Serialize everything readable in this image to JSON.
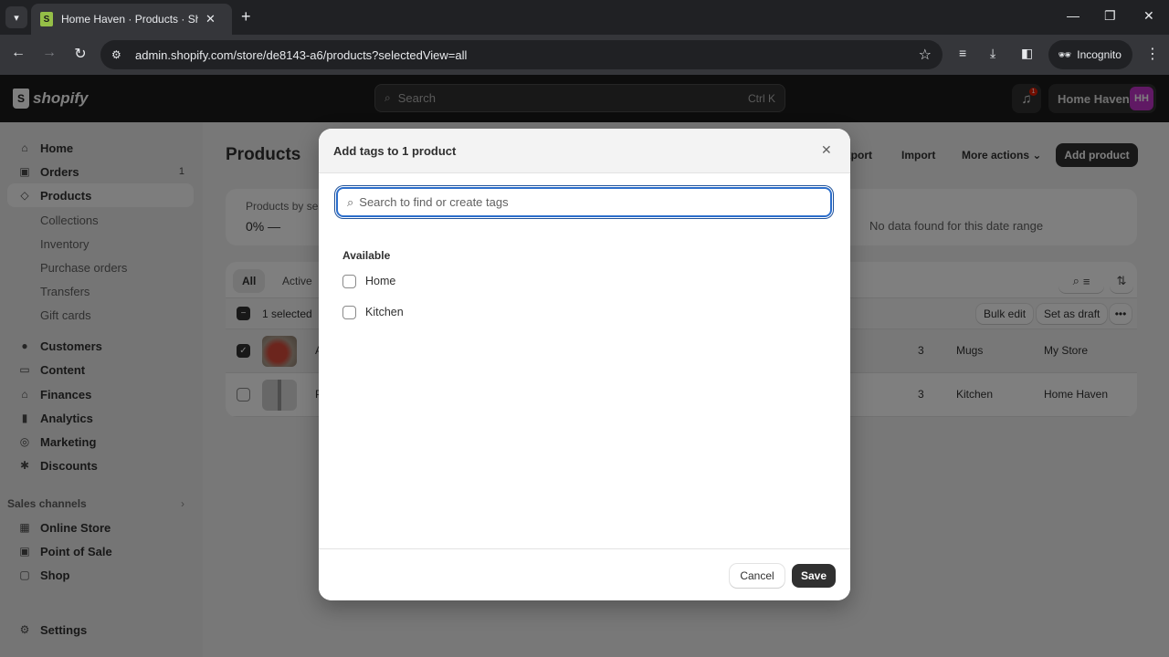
{
  "browser": {
    "tab_title": "Home Haven · Products · Shopify",
    "url": "admin.shopify.com/store/de8143-a6/products?selectedView=all",
    "incognito_label": "Incognito",
    "icons": {
      "tab_search": "▾",
      "favicon": "S",
      "tab_close": "✕",
      "new_tab": "+",
      "back": "←",
      "forward": "→",
      "reload": "↻",
      "site_info": "⚙",
      "star": "☆",
      "media": "≡",
      "download": "⤓",
      "sidepanel": "◧",
      "incognito": "🕶",
      "menu": "⋮",
      "minimize": "—",
      "restore": "❐",
      "close": "✕"
    }
  },
  "topbar": {
    "logo_text": "shopify",
    "search_placeholder": "Search",
    "search_shortcut": "Ctrl K",
    "notification_count": "1",
    "store_name": "Home Haven",
    "avatar_initials": "HH",
    "avatar_color": "#c032c8"
  },
  "sidebar": {
    "items": [
      {
        "label": "Home",
        "icon": "⌂"
      },
      {
        "label": "Orders",
        "icon": "▣",
        "badge": "1"
      },
      {
        "label": "Products",
        "icon": "◇",
        "active": true
      }
    ],
    "product_subitems": [
      "Collections",
      "Inventory",
      "Purchase orders",
      "Transfers",
      "Gift cards"
    ],
    "items2": [
      {
        "label": "Customers",
        "icon": "●"
      },
      {
        "label": "Content",
        "icon": "▭"
      },
      {
        "label": "Finances",
        "icon": "⌂"
      },
      {
        "label": "Analytics",
        "icon": "▮"
      },
      {
        "label": "Marketing",
        "icon": "◎"
      },
      {
        "label": "Discounts",
        "icon": "✱"
      }
    ],
    "sales_channels_label": "Sales channels",
    "channels": [
      {
        "label": "Online Store",
        "icon": "▦"
      },
      {
        "label": "Point of Sale",
        "icon": "▣"
      },
      {
        "label": "Shop",
        "icon": "▢"
      }
    ],
    "settings_label": "Settings",
    "settings_icon": "⚙"
  },
  "main": {
    "page_title": "Products",
    "header_buttons": {
      "export": "Export",
      "import": "Import",
      "more_actions": "More actions ⌄",
      "add_product": "Add product"
    },
    "stats": {
      "label": "Products by sell-through rate",
      "value": "0%  —",
      "message": "No data found for this date range"
    },
    "filter_tabs": [
      "All",
      "Active"
    ],
    "selected_count": "1 selected",
    "bulk_actions": {
      "bulk_edit": "Bulk edit",
      "set_as_draft": "Set as draft",
      "more": "•••"
    },
    "rows": [
      {
        "selected": true,
        "title": "A",
        "inventory": "3",
        "type": "Mugs",
        "vendor": "My Store"
      },
      {
        "selected": false,
        "title": "P",
        "inventory": "3",
        "type": "Kitchen",
        "vendor": "Home Haven"
      }
    ]
  },
  "modal": {
    "title": "Add tags to 1 product",
    "close_icon": "✕",
    "search_placeholder": "Search to find or create tags",
    "search_value": "",
    "available_label": "Available",
    "tags": [
      {
        "label": "Home",
        "checked": false
      },
      {
        "label": "Kitchen",
        "checked": false
      }
    ],
    "cancel_label": "Cancel",
    "save_label": "Save"
  }
}
